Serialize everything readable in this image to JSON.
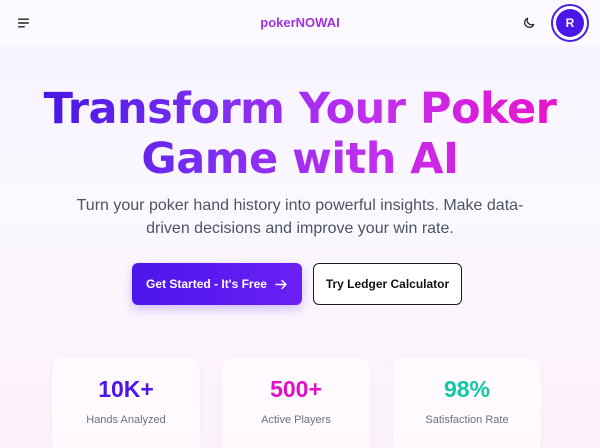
{
  "header": {
    "logo": "pokerNOWAI",
    "avatar_initial": "R",
    "icons": {
      "menu": "menu-icon",
      "theme": "moon-icon"
    }
  },
  "hero": {
    "title_line1": "Transform Your Poker",
    "title_line2": "Game with AI",
    "subtitle": "Turn your poker hand history into powerful insights. Make data-driven decisions and improve your win rate."
  },
  "cta": {
    "primary_label": "Get Started - It's Free",
    "primary_icon": "arrow-right-icon",
    "secondary_label": "Try Ledger Calculator"
  },
  "stats": [
    {
      "value": "10K+",
      "label": "Hands Analyzed",
      "color": "#4c15ea"
    },
    {
      "value": "500+",
      "label": "Active Players",
      "color": "#e011c7"
    },
    {
      "value": "98%",
      "label": "Satisfaction Rate",
      "color": "#10c7a8"
    }
  ],
  "colors": {
    "brand_primary": "#4c15ea",
    "brand_pink": "#e011c7",
    "accent_teal": "#10c7a8"
  }
}
